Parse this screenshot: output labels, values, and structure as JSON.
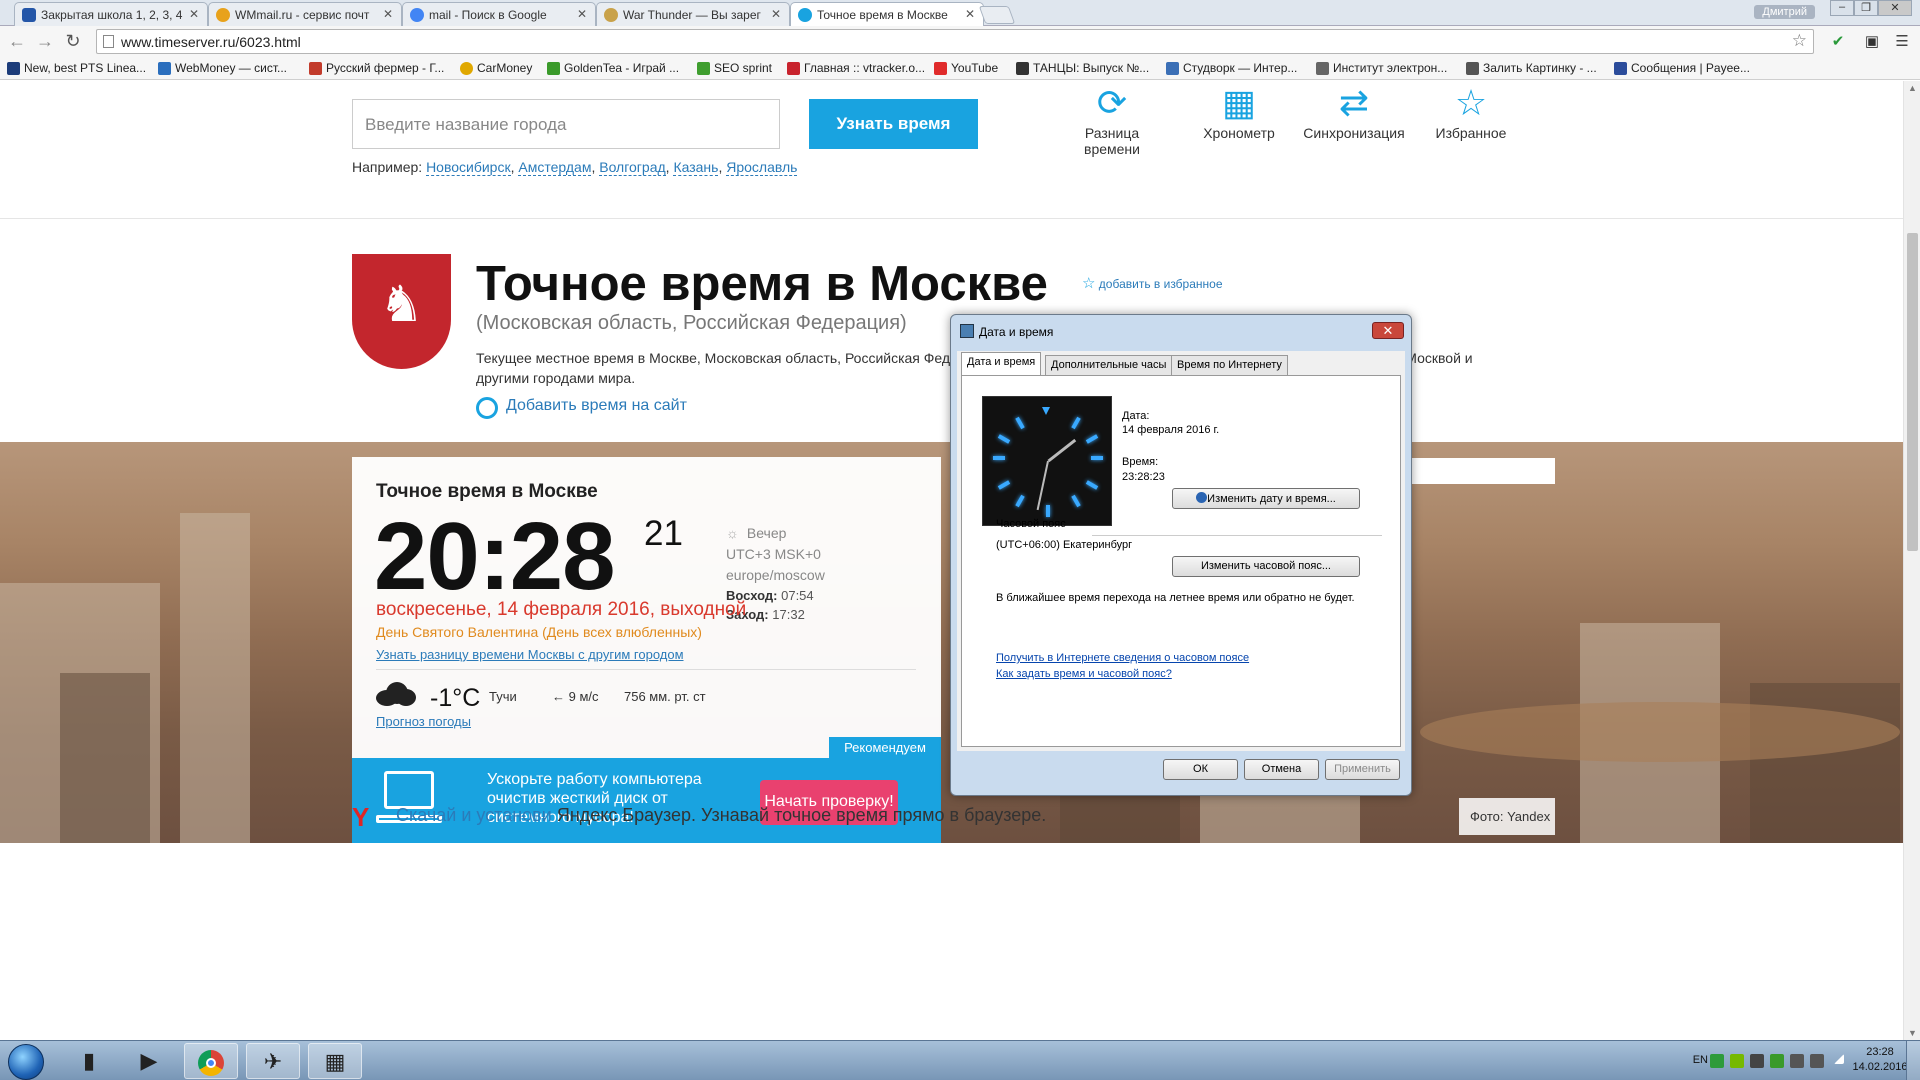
{
  "browser": {
    "tabs": [
      {
        "label": "Закрытая школа 1, 2, 3, 4",
        "active": false,
        "color": "#2456a8"
      },
      {
        "label": "WMmail.ru - сервис почт",
        "active": false,
        "color": "#e8a21c"
      },
      {
        "label": "mail - Поиск в Google",
        "active": false,
        "color": "#4285f4"
      },
      {
        "label": "War Thunder — Вы зарег",
        "active": false,
        "color": "#c9a24a"
      },
      {
        "label": "Точное время в Москве",
        "active": true,
        "color": "#19a3e0"
      }
    ],
    "user_name": "Дмитрий",
    "url": "www.timeserver.ru/6023.html",
    "bookmarks": [
      {
        "label": "New, best PTS Linea...",
        "color": "#1c3c7a"
      },
      {
        "label": "WebMoney — сист...",
        "color": "#2a6ebd"
      },
      {
        "label": "Русский фермер - Г...",
        "color": "#c23b2b"
      },
      {
        "label": "CarMoney",
        "color": "#e0a800"
      },
      {
        "label": "GoldenTea - Играй ...",
        "color": "#3a9a2a"
      },
      {
        "label": "SEO sprint",
        "color": "#3f9e2f"
      },
      {
        "label": "Главная :: vtracker.o...",
        "color": "#c8232d"
      },
      {
        "label": "YouTube",
        "color": "#e02b2b"
      },
      {
        "label": "ТАНЦЫ: Выпуск №...",
        "color": "#333333"
      },
      {
        "label": "Студворк — Интер...",
        "color": "#3b6fb6"
      },
      {
        "label": "Институт электрон...",
        "color": "#666666"
      },
      {
        "label": "Залить Картинку - ...",
        "color": "#555555"
      },
      {
        "label": "Сообщения | Payee...",
        "color": "#2b4c9b"
      }
    ]
  },
  "search": {
    "placeholder": "Введите название города",
    "button_label": "Узнать время",
    "examples_label": "Например:",
    "examples": [
      "Новосибирск",
      "Амстердам",
      "Волгоград",
      "Казань",
      "Ярославль"
    ]
  },
  "tools": [
    {
      "icon": "time-difference-icon",
      "glyph": "⟳",
      "label_line1": "Разница",
      "label_line2": "времени"
    },
    {
      "icon": "stopwatch-icon",
      "glyph": "▦",
      "label_line1": "Хронометр",
      "label_line2": ""
    },
    {
      "icon": "sync-icon",
      "glyph": "⇄",
      "label_line1": "Синхронизация",
      "label_line2": ""
    },
    {
      "icon": "favorites-icon",
      "glyph": "☆",
      "label_line1": "Избранное",
      "label_line2": ""
    }
  ],
  "header": {
    "title": "Точное время в Москве",
    "add_favorite": "добавить в избранное",
    "subtitle": "(Московская область, Российская Федерация)",
    "description": "Текущее местное время в Москве, Московская область, Российская Федерация. Узнайте точное время в Москве или разницу времени между Москвой и другими городами мира.",
    "add_to_site": "Добавить время на сайт"
  },
  "card": {
    "title": "Точное время в Москве",
    "time": "20:28",
    "seconds": "21",
    "period": "Вечер",
    "utc": "UTC+3  MSK+0",
    "zone": "europe/moscow",
    "sunrise_label": "Восход:",
    "sunrise": "07:54",
    "sunset_label": "Заход:",
    "sunset": "17:32",
    "date": "воскресенье, 14 февраля 2016, выходной",
    "holiday": "День Святого Валентина (День всех влюбленных)",
    "diff_link": "Узнать разницу времени Москвы с другим городом",
    "temperature": "-1°C",
    "weather": "Тучи",
    "wind": "9 м/с",
    "pressure": "756 мм. рт. ст",
    "forecast_link": "Прогноз погоды",
    "recommend": "Рекомендуем",
    "promo_text": "Ускорьте работу компьютера очистив жесткий диск от системного мусора!",
    "promo_button": "Начать проверку!"
  },
  "photo_credit": "Фото: Yandex",
  "yandex": {
    "link": "Скачай и установи",
    "text": " Яндекс Браузер. Узнавай точное время прямо в браузере."
  },
  "dialog": {
    "title": "Дата и время",
    "tabs": [
      "Дата и время",
      "Дополнительные часы",
      "Время по Интернету"
    ],
    "date_label": "Дата:",
    "date_value": "14 февраля 2016 г.",
    "time_label": "Время:",
    "time_value": "23:28:23",
    "change_datetime": "Изменить дату и время...",
    "timezone_label": "Часовой пояс",
    "timezone_value": "(UTC+06:00) Екатеринбург",
    "change_timezone": "Изменить часовой пояс...",
    "dst_note": "В ближайшее время перехода на летнее время или обратно не будет.",
    "link1": "Получить в Интернете сведения о часовом поясе",
    "link2": "Как задать время и часовой пояс?",
    "ok": "ОК",
    "cancel": "Отмена",
    "apply": "Применить"
  },
  "taskbar": {
    "lang": "EN",
    "time": "23:28",
    "date": "14.02.2016"
  }
}
